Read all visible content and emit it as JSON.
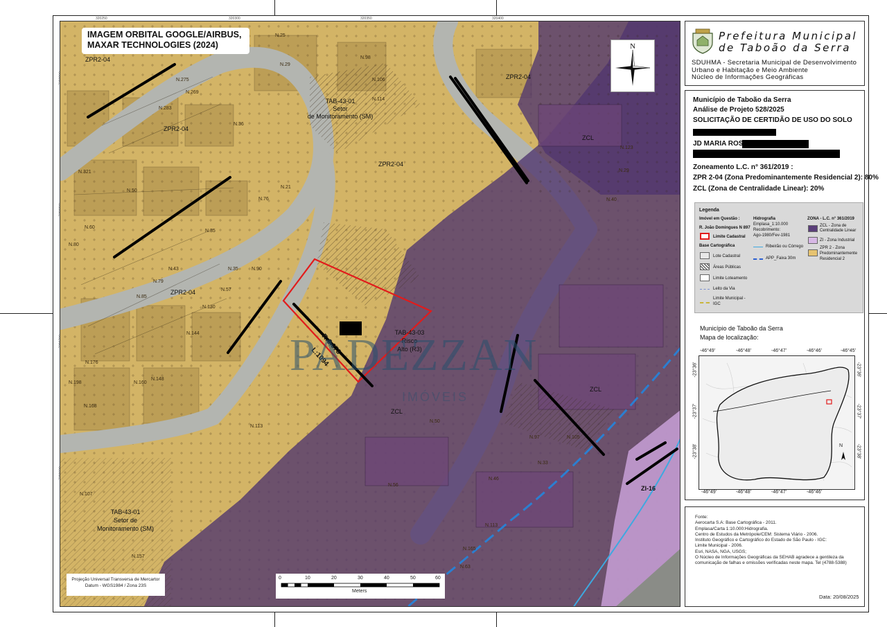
{
  "map": {
    "image_title": "IMAGEM ORBITAL GOOGLE/AIRBUS, MAXAR TECHNOLOGIES (2024)",
    "north_label": "N",
    "coords_top": [
      "320250",
      "320300",
      "320350",
      "320400"
    ],
    "coords_left": [
      "7390900",
      "7390800",
      "7390700",
      "7390600"
    ],
    "zone_labels": {
      "zpr_tl": "ZPR2-04",
      "zpr_tr": "ZPR2-04",
      "zpr_1": "ZPR2-04",
      "zpr_2": "ZPR2-04",
      "zpr_3": "ZPR2-04",
      "zcl_1": "ZCL",
      "zcl_2": "ZCL",
      "zcl_3": "ZCL",
      "zi": "ZI-16"
    },
    "sector_top": {
      "line1": "TAB-43-01",
      "line2": "Setor",
      "line3": "de Monitoramento (SM)"
    },
    "sector_bottom": {
      "line1": "TAB-43-01",
      "line2": "Setor de",
      "line3": "Monitoramento (SM)"
    },
    "risk": {
      "line1": "TAB-43-03",
      "line2": "Risco",
      "line3": "Alto (R3)"
    },
    "parcel": {
      "r": "R:3.973",
      "l": "L:1094"
    },
    "lot_numbers": [
      "N.25",
      "N.29",
      "N.98",
      "N.106",
      "N.114",
      "N.36",
      "N.269",
      "N.275",
      "N.283",
      "N.21",
      "N.76",
      "N.50",
      "N.43",
      "N.35",
      "N.321",
      "N.60",
      "N.80",
      "N.90",
      "N.35",
      "N.57",
      "N.130",
      "N.144",
      "N.148",
      "N.160",
      "N.168",
      "N.176",
      "N.198",
      "N.113",
      "N.123",
      "N.29",
      "N.40",
      "N.50",
      "N.56",
      "N.46",
      "N.97",
      "N.113",
      "N.33",
      "N.107",
      "N.157",
      "N.79",
      "N.85",
      "N.165",
      "N.63",
      "N.105"
    ],
    "watermark": "PADEZZAN",
    "watermark_sub": "IMÓVEIS",
    "projection": {
      "line1": "Projeção Universal Transversa de Mercartor",
      "line2": "Datum - WGS1984 / Zona 23S"
    },
    "scale": {
      "ticks": [
        "0",
        "10",
        "20",
        "30",
        "40",
        "50",
        "60"
      ],
      "unit": "Meters"
    }
  },
  "colors": {
    "zpr": "#d8b96a",
    "zcl": "#5b3f7a",
    "zi": "#c59fd3",
    "parcel": "#e21b1b",
    "road": "#aeb0ac",
    "stream": "#2b7fd1"
  },
  "header": {
    "title_line1": "Prefeitura Municipal",
    "title_line2": "de Taboão da Serra",
    "sub_line1": "SDUHMA - Secretaria Municipal de Desenvolvimento",
    "sub_line2": "Urbano e Habitação e Meio Ambiente",
    "sub_line3": "Núcleo de Informações Geográficas"
  },
  "project": {
    "municipio": "Município de Taboão da Serra",
    "analise": "Análise de Projeto 528/2025",
    "solicitacao": "SOLICITAÇÃO DE CERTIDÃO DE USO DO SOLO",
    "bairro": "JD MARIA ROSA",
    "zoneamento": "Zoneamento L.C. n° 361/2019 :",
    "zpr_pct": "ZPR 2-04 (Zona Predominantemente Residencial 2): 80%",
    "zcl_pct": "ZCL (Zona de Centralidade Linear): 20%"
  },
  "legend": {
    "title": "Legenda",
    "imovel": "Imóvel em Questão :",
    "endereco": "R. João Domingues   N 897",
    "limite_cadastral": "Limite Cadastral",
    "base": "Base Cartográfica",
    "lote": "Lote Cadastral",
    "areas": "Áreas Públicas",
    "loteamento": "Limite Loteamento",
    "leito": "Leito da Via",
    "municipal": "Limite Municipal -",
    "igc": "IGC",
    "hidro_title": "Hidrografia",
    "hidro_1": "Emplasa_1:10.000",
    "hidro_2": "Recobrimento:",
    "hidro_3": "Ago-1980/Fev-1981",
    "ribeirao": "Ribeirão ou Córrego",
    "app": "APP_Faixa 30m",
    "zona_title": "ZONA - L.C. n° 361/2019",
    "zcl_a": "ZCL - Zona de",
    "zcl_b": "Centralidade Linear",
    "zi": "ZI - Zona Industrial",
    "zpr_a": "ZPR 2 - Zona",
    "zpr_b": "Predominantemente",
    "zpr_c": "Residencial 2"
  },
  "location": {
    "title": "Município de Taboão da Serra",
    "subtitle": "Mapa de localização:",
    "lon_ticks": [
      "-46°49'",
      "-46°48'",
      "-46°47'",
      "-46°46'",
      "-46°45'"
    ],
    "lon_ticks_bottom": [
      "-46°49'",
      "-46°48'",
      "-46°47'",
      "-46°46'"
    ],
    "lat_ticks": [
      "-23°36'",
      "-23°37'",
      "-23°38'"
    ],
    "north": "N"
  },
  "sources": {
    "l1": "Fonte:",
    "l2": "Aerocarta S.A: Base Cartográfica - 2011.",
    "l3": "Emplasa/Carta 1:10.000:Hidrografia.",
    "l4": "Centro de Estudos da Metrópole/CEM: Sistema Viário - 2006.",
    "l5": "Instituto Geográfico e Cartográfico do Estado de São Paulo - IGC:",
    "l6": "Limite Municipal - 2006.",
    "l7": "Esri, NASA, NGA, USGS;",
    "l8": "O Núcleo de Informações Geográficas da SEHAB agradece a gentileza da",
    "l9": "comunicação de falhas e omissões verificadas neste mapa. Tel (4788-5388)"
  },
  "date": "Data: 20/08/2025"
}
